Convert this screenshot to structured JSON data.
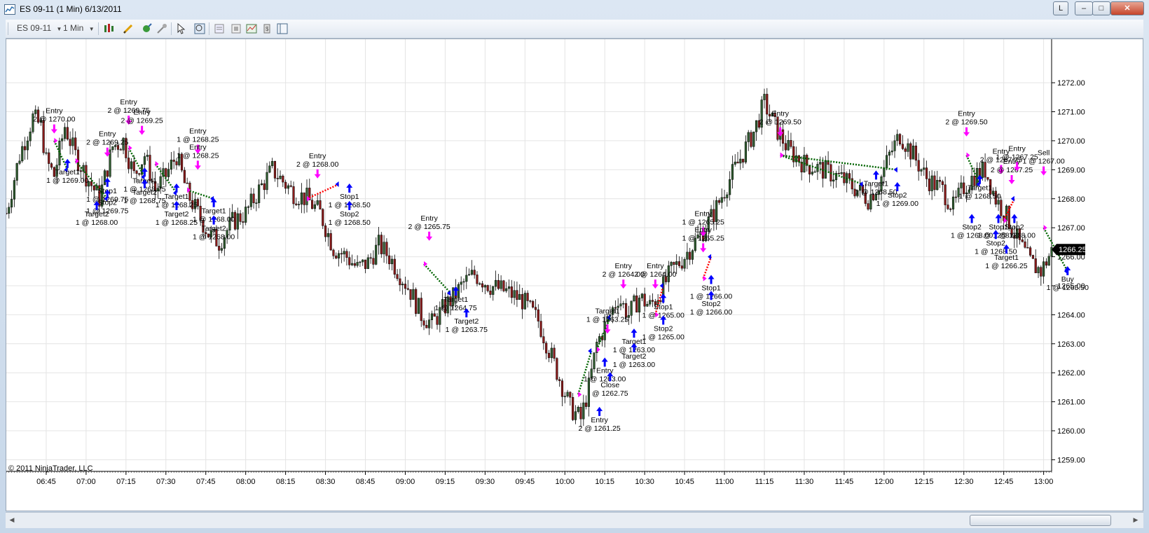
{
  "window": {
    "title": "ES 09-11 (1 Min)  6/13/2011",
    "buttons": {
      "link": "L",
      "minimize": "–",
      "maximize": "□",
      "close": "✕"
    }
  },
  "toolbar": {
    "instrument": "ES 09-11",
    "interval": "1 Min",
    "icons": [
      "bar-type-icon",
      "drawing-pen-icon",
      "connect-icon",
      "chart-trader-icon",
      "cursor-icon",
      "zoom-icon",
      "data-box-icon",
      "properties-icon",
      "indicators-icon",
      "strategies-icon",
      "panel-icon"
    ]
  },
  "chart": {
    "copyright": "© 2011 NinjaTrader, LLC",
    "current_price": "1266.25",
    "colors": {
      "up": "#2f5c2f",
      "down": "#8b1a1a",
      "entry_arrow": "#ff00ff",
      "exit_arrow": "#0000ff",
      "win_line": "#006400",
      "loss_line": "#ff0000"
    }
  },
  "chart_data": {
    "type": "candlestick",
    "y_ticks": [
      "1259.00",
      "1260.00",
      "1261.00",
      "1262.00",
      "1263.00",
      "1264.00",
      "1265.00",
      "1266.00",
      "1267.00",
      "1268.00",
      "1269.00",
      "1270.00",
      "1271.00",
      "1272.00"
    ],
    "ylim": [
      1258.6,
      1273.5
    ],
    "x_ticks": [
      "06:45",
      "07:00",
      "07:15",
      "07:30",
      "07:45",
      "08:00",
      "08:15",
      "08:30",
      "08:45",
      "09:00",
      "09:15",
      "09:30",
      "09:45",
      "10:00",
      "10:15",
      "10:30",
      "10:45",
      "11:00",
      "11:15",
      "11:30",
      "11:45",
      "12:00",
      "12:15",
      "12:30",
      "12:45",
      "13:00"
    ],
    "xlim_minutes": [
      390,
      783
    ],
    "price_path": [
      [
        390,
        1267.5
      ],
      [
        395,
        1269.5
      ],
      [
        400,
        1270.8
      ],
      [
        403,
        1270.5
      ],
      [
        405,
        1269.3
      ],
      [
        408,
        1268.8
      ],
      [
        412,
        1270.5
      ],
      [
        416,
        1269.5
      ],
      [
        420,
        1268.8
      ],
      [
        425,
        1268.0
      ],
      [
        430,
        1269.8
      ],
      [
        434,
        1270.0
      ],
      [
        438,
        1268.8
      ],
      [
        442,
        1269.5
      ],
      [
        446,
        1268.3
      ],
      [
        450,
        1268.8
      ],
      [
        454,
        1269.5
      ],
      [
        458,
        1268.2
      ],
      [
        462,
        1267.5
      ],
      [
        466,
        1266.8
      ],
      [
        470,
        1266.5
      ],
      [
        475,
        1267.2
      ],
      [
        480,
        1267.5
      ],
      [
        485,
        1268.3
      ],
      [
        490,
        1269.0
      ],
      [
        494,
        1268.6
      ],
      [
        498,
        1268.2
      ],
      [
        503,
        1268.0
      ],
      [
        508,
        1267.5
      ],
      [
        513,
        1266.3
      ],
      [
        518,
        1266.0
      ],
      [
        522,
        1265.6
      ],
      [
        526,
        1265.8
      ],
      [
        530,
        1266.4
      ],
      [
        534,
        1266.0
      ],
      [
        538,
        1265.4
      ],
      [
        542,
        1264.8
      ],
      [
        546,
        1264.0
      ],
      [
        550,
        1263.7
      ],
      [
        555,
        1264.3
      ],
      [
        558,
        1264.6
      ],
      [
        562,
        1265.1
      ],
      [
        566,
        1265.4
      ],
      [
        572,
        1265.0
      ],
      [
        578,
        1264.8
      ],
      [
        584,
        1264.5
      ],
      [
        590,
        1263.8
      ],
      [
        594,
        1262.8
      ],
      [
        598,
        1261.8
      ],
      [
        602,
        1260.8
      ],
      [
        606,
        1260.4
      ],
      [
        609,
        1261.5
      ],
      [
        612,
        1263.0
      ],
      [
        616,
        1263.8
      ],
      [
        620,
        1264.6
      ],
      [
        624,
        1264.0
      ],
      [
        628,
        1264.6
      ],
      [
        632,
        1264.3
      ],
      [
        636,
        1264.8
      ],
      [
        640,
        1265.5
      ],
      [
        644,
        1265.9
      ],
      [
        648,
        1266.4
      ],
      [
        652,
        1266.9
      ],
      [
        656,
        1267.5
      ],
      [
        661,
        1268.5
      ],
      [
        666,
        1269.4
      ],
      [
        671,
        1270.3
      ],
      [
        675,
        1271.3
      ],
      [
        679,
        1270.5
      ],
      [
        684,
        1269.7
      ],
      [
        690,
        1269.2
      ],
      [
        697,
        1269.0
      ],
      [
        704,
        1268.7
      ],
      [
        710,
        1268.3
      ],
      [
        714,
        1268.0
      ],
      [
        718,
        1268.5
      ],
      [
        722,
        1269.5
      ],
      [
        726,
        1270.2
      ],
      [
        731,
        1269.5
      ],
      [
        736,
        1268.7
      ],
      [
        742,
        1268.3
      ],
      [
        746,
        1267.7
      ],
      [
        750,
        1268.4
      ],
      [
        754,
        1268.8
      ],
      [
        758,
        1269.0
      ],
      [
        762,
        1268.0
      ],
      [
        766,
        1267.4
      ],
      [
        770,
        1266.6
      ],
      [
        775,
        1265.8
      ],
      [
        779,
        1265.5
      ],
      [
        783,
        1266.2
      ]
    ],
    "trades": [
      {
        "label": "Entry",
        "qty_price": "2 @ 1270.00",
        "x": 408,
        "y": 1270.95,
        "side": "above"
      },
      {
        "label": "Target1",
        "qty_price": "1 @ 1269.00",
        "x": 413,
        "y": 1268.65,
        "side": "below"
      },
      {
        "label": "Entry",
        "qty_price": "2 @ 1269.75",
        "x": 436,
        "y": 1271.25,
        "side": "above"
      },
      {
        "label": "Entry",
        "qty_price": "2 @ 1269.25",
        "x": 441,
        "y": 1270.9,
        "side": "above"
      },
      {
        "label": "Entry",
        "qty_price": "2 @ 1269.25",
        "x": 428,
        "y": 1270.15,
        "side": "above"
      },
      {
        "label": "Stop1",
        "qty_price": "1 @ 1269.75",
        "x": 428,
        "y": 1268.0,
        "side": "below"
      },
      {
        "label": "Stop2",
        "qty_price": "1 @ 1269.75",
        "x": 428,
        "y": 1267.6,
        "side": "below"
      },
      {
        "label": "Target2",
        "qty_price": "1 @ 1268.00",
        "x": 424,
        "y": 1267.2,
        "side": "below"
      },
      {
        "label": "Target1",
        "qty_price": "1 @ 1268.75",
        "x": 442,
        "y": 1268.35,
        "side": "below"
      },
      {
        "label": "Target2",
        "qty_price": "1 @ 1268.75",
        "x": 442,
        "y": 1267.95,
        "side": "below"
      },
      {
        "label": "Target1",
        "qty_price": "1 @ 1268.25",
        "x": 454,
        "y": 1267.8,
        "side": "below"
      },
      {
        "label": "Target2",
        "qty_price": "1 @ 1268.25",
        "x": 454,
        "y": 1267.2,
        "side": "below"
      },
      {
        "label": "Entry",
        "qty_price": "1 @ 1268.25",
        "x": 462,
        "y": 1270.25,
        "side": "above"
      },
      {
        "label": "Entry",
        "qty_price": "1 @ 1268.25",
        "x": 462,
        "y": 1269.7,
        "side": "above"
      },
      {
        "label": "Target1",
        "qty_price": "1 @ 1268.00",
        "x": 468,
        "y": 1267.3,
        "side": "below"
      },
      {
        "label": "Target2",
        "qty_price": "1 @ 1268.00",
        "x": 468,
        "y": 1266.7,
        "side": "below"
      },
      {
        "label": "Entry",
        "qty_price": "2 @ 1268.00",
        "x": 507,
        "y": 1269.4,
        "side": "above"
      },
      {
        "label": "Stop1",
        "qty_price": "1 @ 1268.50",
        "x": 519,
        "y": 1267.8,
        "side": "below"
      },
      {
        "label": "Stop2",
        "qty_price": "1 @ 1268.50",
        "x": 519,
        "y": 1267.2,
        "side": "below"
      },
      {
        "label": "Entry",
        "qty_price": "2 @ 1265.75",
        "x": 549,
        "y": 1267.25,
        "side": "above"
      },
      {
        "label": "Target1",
        "qty_price": "1 @ 1264.75",
        "x": 559,
        "y": 1264.25,
        "side": "below"
      },
      {
        "label": "Target2",
        "qty_price": "1 @ 1263.75",
        "x": 563,
        "y": 1263.5,
        "side": "below"
      },
      {
        "label": "Entry",
        "qty_price": "2 @ 1264.00",
        "x": 622,
        "y": 1265.6,
        "side": "above"
      },
      {
        "label": "Target1",
        "qty_price": "1 @ 1263.25",
        "x": 616,
        "y": 1264.05,
        "side": "above"
      },
      {
        "label": "Target1",
        "qty_price": "1 @ 1263.00",
        "x": 626,
        "y": 1262.8,
        "side": "below"
      },
      {
        "label": "Target2",
        "qty_price": "1 @ 1263.00",
        "x": 626,
        "y": 1262.3,
        "side": "below"
      },
      {
        "label": "Entry",
        "qty_price": "1 @ 1263.00",
        "x": 615,
        "y": 1261.8,
        "side": "below"
      },
      {
        "label": "Close",
        "qty_price": "@ 1262.75",
        "x": 617,
        "y": 1261.3,
        "side": "below"
      },
      {
        "label": "Entry",
        "qty_price": "2 @ 1261.25",
        "x": 613,
        "y": 1260.1,
        "side": "below"
      },
      {
        "label": "Entry",
        "qty_price": "2 @ 1264.00",
        "x": 634,
        "y": 1265.6,
        "side": "above"
      },
      {
        "label": "Stop1",
        "qty_price": "1 @ 1265.00",
        "x": 637,
        "y": 1264.0,
        "side": "below"
      },
      {
        "label": "Stop2",
        "qty_price": "1 @ 1265.00",
        "x": 637,
        "y": 1263.25,
        "side": "below"
      },
      {
        "label": "Entry",
        "qty_price": "1 @ 1265.25",
        "x": 652,
        "y": 1267.4,
        "side": "above"
      },
      {
        "label": "Entry",
        "qty_price": "1 @ 1265.25",
        "x": 652,
        "y": 1266.85,
        "side": "above"
      },
      {
        "label": "Stop1",
        "qty_price": "1 @ 1266.00",
        "x": 655,
        "y": 1264.65,
        "side": "below"
      },
      {
        "label": "Stop2",
        "qty_price": "1 @ 1266.00",
        "x": 655,
        "y": 1264.1,
        "side": "below"
      },
      {
        "label": "Entry",
        "qty_price": "2 @ 1269.50",
        "x": 681,
        "y": 1270.85,
        "side": "above"
      },
      {
        "label": "Target1",
        "qty_price": "1 @ 1268.50",
        "x": 717,
        "y": 1268.25,
        "side": "below"
      },
      {
        "label": "Stop2",
        "qty_price": "1 @ 1269.00",
        "x": 725,
        "y": 1267.85,
        "side": "below"
      },
      {
        "label": "Entry",
        "qty_price": "2 @ 1269.50",
        "x": 751,
        "y": 1270.85,
        "side": "above"
      },
      {
        "label": "Target1",
        "qty_price": "1 @ 1268.50",
        "x": 756,
        "y": 1268.1,
        "side": "below"
      },
      {
        "label": "Stop2",
        "qty_price": "1 @ 1268.00",
        "x": 753,
        "y": 1266.75,
        "side": "below"
      },
      {
        "label": "Entry",
        "qty_price": "2 @ 1267.25",
        "x": 764,
        "y": 1269.55,
        "side": "above"
      },
      {
        "label": "Entry",
        "qty_price": "2 @ 1267.25",
        "x": 768,
        "y": 1269.2,
        "side": "above"
      },
      {
        "label": "Entry",
        "qty_price": "1 @ 1267.25",
        "x": 770,
        "y": 1269.65,
        "side": "above"
      },
      {
        "label": "Stop1",
        "qty_price": "1 @ 1268.00",
        "x": 763,
        "y": 1266.75,
        "side": "below"
      },
      {
        "label": "Stop2",
        "qty_price": "1 @ 1268.00",
        "x": 769,
        "y": 1266.75,
        "side": "below"
      },
      {
        "label": "Stop2",
        "qty_price": "1 @ 1268.50",
        "x": 762,
        "y": 1266.2,
        "side": "below"
      },
      {
        "label": "Target1",
        "qty_price": "1 @ 1266.25",
        "x": 766,
        "y": 1265.7,
        "side": "below"
      },
      {
        "label": "Sell",
        "qty_price": "1 @ 1267.00",
        "x": 780,
        "y": 1269.5,
        "side": "above"
      },
      {
        "label": "Buy",
        "qty_price": "1 @ 1265.50",
        "x": 789,
        "y": 1264.95,
        "side": "below"
      }
    ],
    "trade_lines": [
      [
        408,
        1270.0,
        413,
        1269.0,
        "win"
      ],
      [
        416,
        1269.3,
        428,
        1268.0,
        "win"
      ],
      [
        436,
        1269.75,
        442,
        1268.75,
        "win"
      ],
      [
        446,
        1269.2,
        454,
        1268.2,
        "win"
      ],
      [
        458,
        1268.3,
        468,
        1268.0,
        "win"
      ],
      [
        503,
        1268.0,
        515,
        1268.5,
        "loss"
      ],
      [
        547,
        1265.75,
        557,
        1264.75,
        "win"
      ],
      [
        605,
        1261.25,
        610,
        1262.75,
        "win"
      ],
      [
        612,
        1262.8,
        617,
        1263.9,
        "win"
      ],
      [
        634,
        1264.0,
        637,
        1265.0,
        "loss"
      ],
      [
        652,
        1265.25,
        655,
        1266.0,
        "loss"
      ],
      [
        681,
        1269.5,
        712,
        1268.5,
        "win"
      ],
      [
        681,
        1269.5,
        725,
        1269.0,
        "win"
      ],
      [
        751,
        1269.5,
        756,
        1268.5,
        "win"
      ],
      [
        765,
        1267.25,
        769,
        1268.0,
        "loss"
      ],
      [
        780,
        1267.0,
        789,
        1265.5,
        "win"
      ]
    ]
  }
}
